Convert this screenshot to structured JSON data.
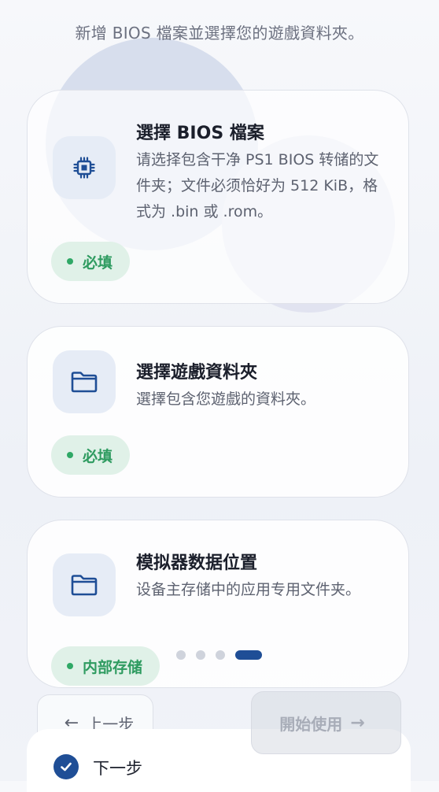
{
  "subtitle": "新增 BIOS 檔案並選擇您的遊戲資料夾。",
  "cards": [
    {
      "title": "選擇 BIOS 檔案",
      "description": "请选择包含干净 PS1 BIOS 转储的文件夹；文件必须恰好为 512 KiB，格式为 .bin 或 .rom。",
      "badge": "必填",
      "icon": "chip-icon"
    },
    {
      "title": "選擇遊戲資料夾",
      "description": "選擇包含您遊戲的資料夾。",
      "badge": "必填",
      "icon": "folder-icon"
    },
    {
      "title": "模拟器数据位置",
      "description": "设备主存储中的应用专用文件夹。",
      "badge": "内部存储",
      "icon": "folder-icon"
    }
  ],
  "pager": {
    "total": 4,
    "active": 4
  },
  "buttons": {
    "prev": "上一步",
    "start": "開始使用"
  },
  "next_step": {
    "label": "下一步",
    "icon": "check-circle-icon"
  },
  "colors": {
    "accent": "#1f4e96",
    "badge_green": "#2e9b60",
    "badge_bg": "#e0f1e8"
  }
}
